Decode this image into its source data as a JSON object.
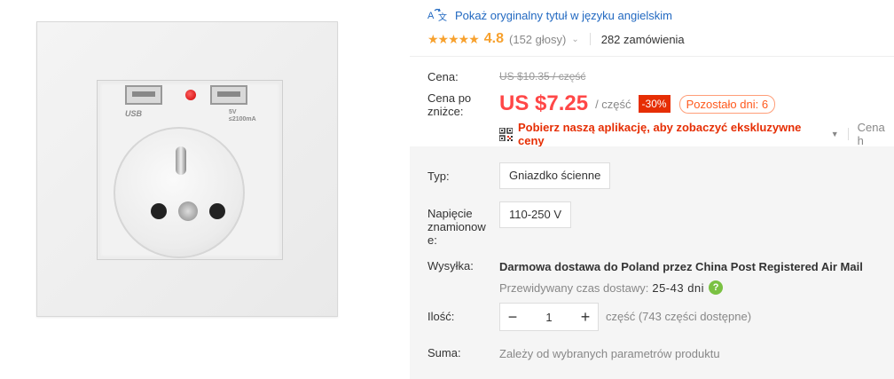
{
  "product_image": {
    "usb_label_left": "USB",
    "usb_label_right_1": "5V",
    "usb_label_right_2": "≤2100mA"
  },
  "title": {
    "icon": "translate-icon",
    "text": "Pokaż oryginalny tytuł w języku angielskim"
  },
  "rating": {
    "stars": "★★★★★",
    "value": "4.8",
    "count": "(152 głosy)",
    "chevron": "⌄",
    "orders": "282 zamówienia"
  },
  "price": {
    "label_original": "Cena:",
    "original": "US $10.35 / część",
    "label_discounted_1": "Cena po",
    "label_discounted_2": "zniżce:",
    "discounted": "US $7.25",
    "per_unit": "/ część",
    "discount": "-30%",
    "days_left": "Pozostało dni: 6"
  },
  "app_promo": {
    "icon": "qr-code-icon",
    "text": "Pobierz naszą aplikację, aby zobaczyć ekskluzywne ceny",
    "caret": "▼",
    "link": "Cena h"
  },
  "specs": {
    "type_label": "Typ:",
    "type_value": "Gniazdko ścienne",
    "voltage_label_1": "Napięcie",
    "voltage_label_2": "znamionow",
    "voltage_label_3": "e:",
    "voltage_value": "110-250 V"
  },
  "shipping": {
    "label": "Wysyłka:",
    "free": "Darmowa dostawa do",
    "rest": "Poland przez China Post Registered Air Mail",
    "estimate_label": "Przewidywany czas dostawy:",
    "estimate_value": "25-43 dni",
    "help": "?"
  },
  "quantity": {
    "label": "Ilość:",
    "minus": "−",
    "value": "1",
    "plus": "+",
    "note": "część (743 części dostępne)"
  },
  "total": {
    "label": "Suma:",
    "value": "Zależy od wybranych parametrów produktu"
  },
  "colors": {
    "price_red": "#ff4747",
    "link_blue": "#2269c1",
    "star_orange": "#f7a12e",
    "badge_red": "#e62e04",
    "help_green": "#7ac142"
  }
}
